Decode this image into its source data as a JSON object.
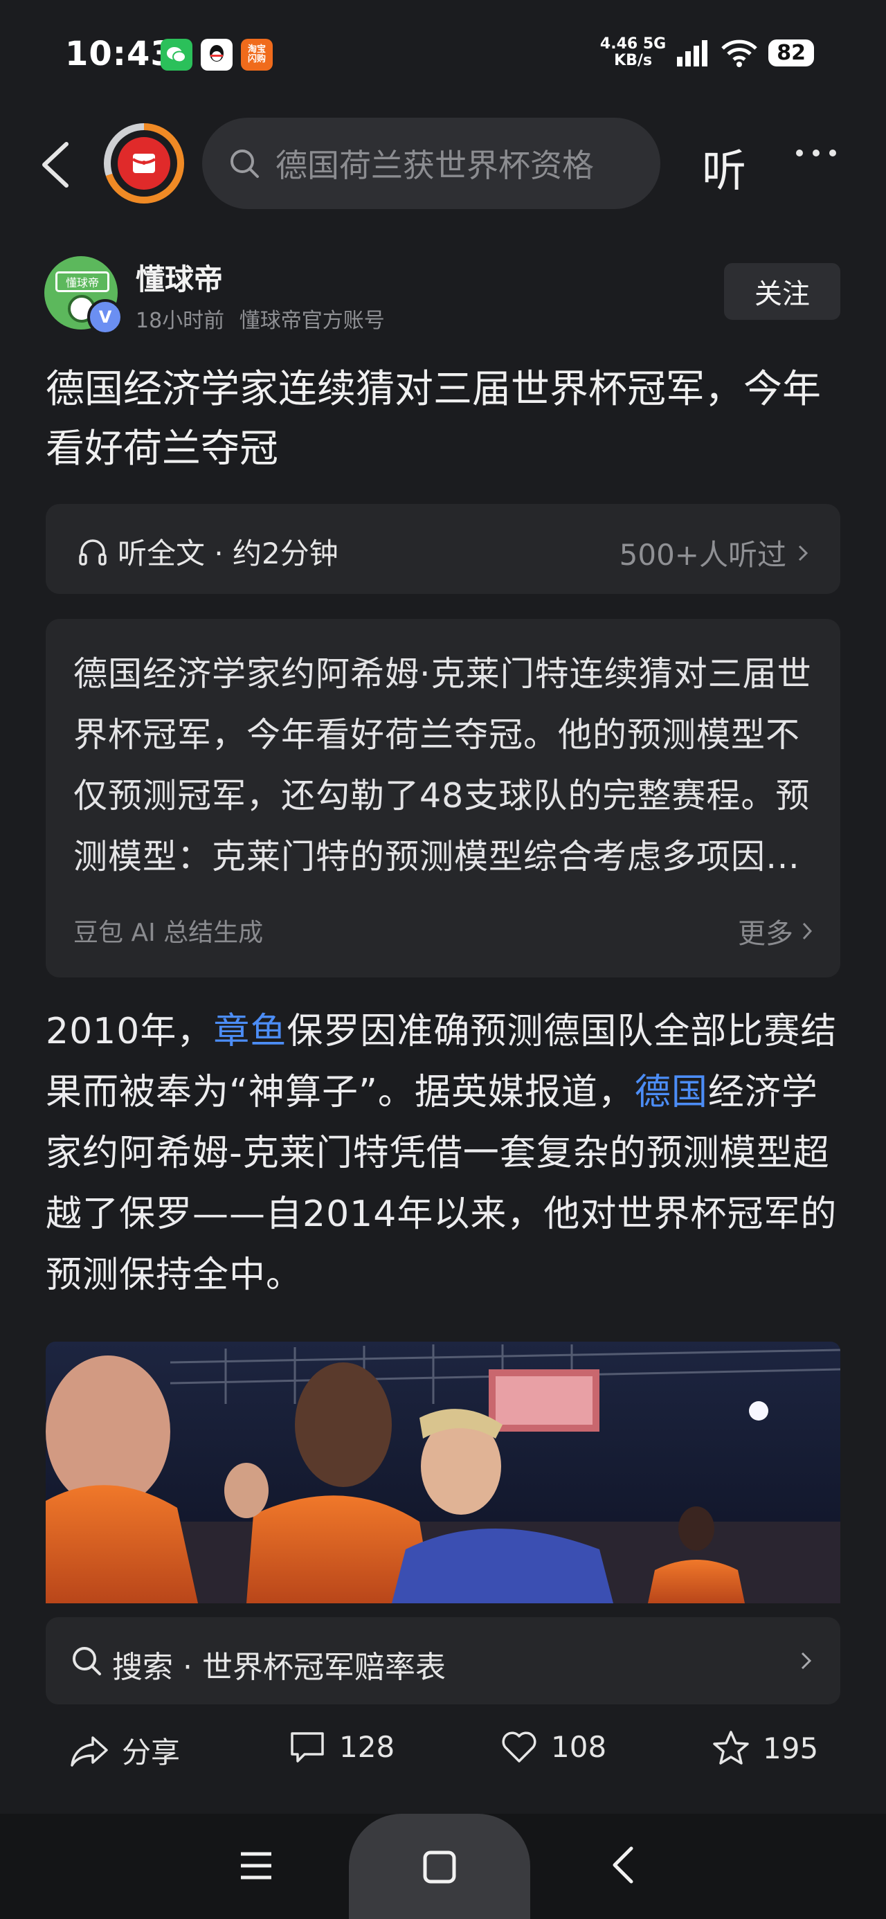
{
  "status_bar": {
    "time": "10:43",
    "apps": [
      {
        "icon": "wechat-icon",
        "color": "#2bc05a",
        "label": ""
      },
      {
        "icon": "qq-icon",
        "color": "#ffffff",
        "label": ""
      },
      {
        "icon": "taobao-flash-icon",
        "color": "#f06b1c",
        "label": "淘宝\n闪购"
      }
    ],
    "net_speed": "4.46",
    "net_unit": "KB/s",
    "net_type": "5G",
    "wifi_sub": "6",
    "battery": "82"
  },
  "top_bar": {
    "search_placeholder": "德国荷兰获世界杯资格",
    "listen_label": "听"
  },
  "author": {
    "avatar_sign": "懂球帝",
    "verified_mark": "V",
    "name": "懂球帝",
    "time_ago": "18小时前",
    "account_type": "懂球帝官方账号",
    "follow_label": "关注"
  },
  "article": {
    "title": "德国经济学家连续猜对三届世界杯冠军，今年看好荷兰夺冠",
    "audio": {
      "label": "听全文 · 约2分钟",
      "listeners": "500+人听过"
    },
    "summary": {
      "text": "德国经济学家约阿希姆·克莱门特连续猜对三届世界杯冠军，今年看好荷兰夺冠。他的预测模型不仅预测冠军，还勾勒了48支球队的完整赛程。预测模型：克莱门特的预测模型综合考虑多项因素……",
      "source": "豆包 AI 总结生成",
      "more_label": "更多"
    },
    "body": {
      "p1": "2010年，",
      "link1": "章鱼",
      "p2": "保罗因准确预测德国队全部比赛结果而被奉为“神算子”。据英媒报道，",
      "link2": "德国",
      "p3": "经济学家约阿希姆-克莱门特凭借一套复杂的预测模型超越了保罗——自2014年以来，他对世界杯冠军的预测保持全中。"
    }
  },
  "hot_search": {
    "label": "搜索 · 世界杯冠军赔率表"
  },
  "actions": {
    "share_label": "分享",
    "comments": "128",
    "likes": "108",
    "favorites": "195"
  },
  "colors": {
    "background": "#1b1c1f",
    "card": "#26272a",
    "link": "#4c8df6",
    "accent_orange": "#f08a25"
  }
}
